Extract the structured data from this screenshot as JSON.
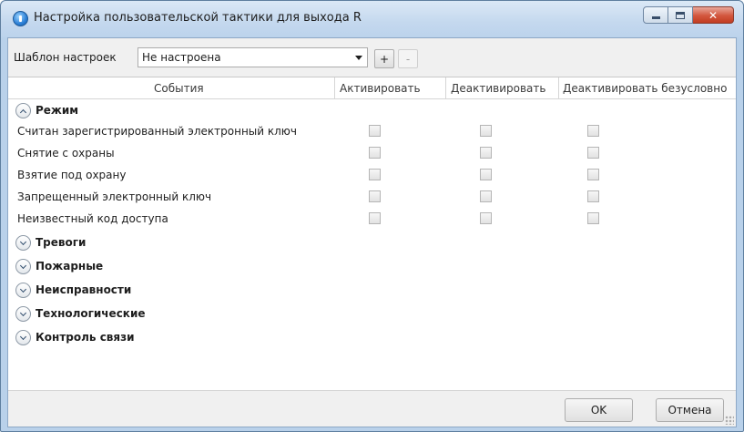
{
  "window": {
    "title": "Настройка пользовательской тактики для выхода R",
    "icon": "info-icon",
    "controls": {
      "minimize": "minimize-icon",
      "maximize": "maximize-icon",
      "close": "close-icon",
      "close_glyph": "✕"
    }
  },
  "toolbar": {
    "template_label": "Шаблон настроек",
    "template_value": "Не настроена",
    "add_label": "+",
    "remove_label": "-"
  },
  "table": {
    "columns": [
      "События",
      "Активировать",
      "Деактивировать",
      "Деактивировать безусловно"
    ],
    "groups": [
      {
        "label": "Режим",
        "expanded": true,
        "events": [
          {
            "label": "Считан зарегистрированный электронный ключ",
            "activate": false,
            "deactivate": false,
            "deactivate_unconditional": false
          },
          {
            "label": "Снятие с охраны",
            "activate": false,
            "deactivate": false,
            "deactivate_unconditional": false
          },
          {
            "label": "Взятие под охрану",
            "activate": false,
            "deactivate": false,
            "deactivate_unconditional": false
          },
          {
            "label": "Запрещенный электронный ключ",
            "activate": false,
            "deactivate": false,
            "deactivate_unconditional": false
          },
          {
            "label": "Неизвестный код доступа",
            "activate": false,
            "deactivate": false,
            "deactivate_unconditional": false
          }
        ]
      },
      {
        "label": "Тревоги",
        "expanded": false
      },
      {
        "label": "Пожарные",
        "expanded": false
      },
      {
        "label": "Неисправности",
        "expanded": false
      },
      {
        "label": "Технологические",
        "expanded": false
      },
      {
        "label": "Контроль связи",
        "expanded": false
      }
    ]
  },
  "footer": {
    "ok_label": "OK",
    "cancel_label": "Отмена"
  },
  "colors": {
    "title_bar": "#c4d8ee",
    "close_button": "#d2563d",
    "dialog_background": "#f0f0f0"
  }
}
